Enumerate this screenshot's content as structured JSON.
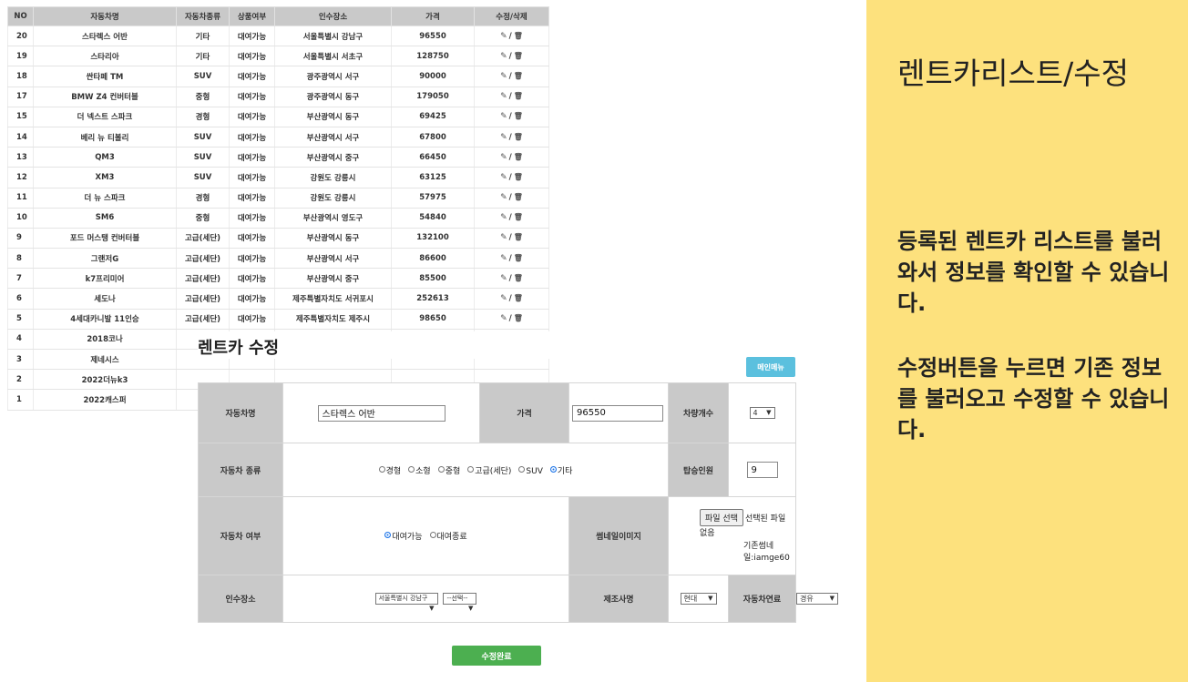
{
  "list": {
    "headers": [
      "NO",
      "자동차명",
      "자동차종류",
      "상품여부",
      "인수장소",
      "가격",
      "수정/삭제"
    ],
    "rows": [
      {
        "no": "20",
        "name": "스타렉스 어반",
        "type": "기타",
        "status": "대여가능",
        "place": "서울특별시 강남구",
        "price": "96550"
      },
      {
        "no": "19",
        "name": "스타리아",
        "type": "기타",
        "status": "대여가능",
        "place": "서울특별시 서초구",
        "price": "128750"
      },
      {
        "no": "18",
        "name": "싼타페 TM",
        "type": "SUV",
        "status": "대여가능",
        "place": "광주광역시 서구",
        "price": "90000"
      },
      {
        "no": "17",
        "name": "BMW Z4 컨버터블",
        "type": "중형",
        "status": "대여가능",
        "place": "광주광역시 동구",
        "price": "179050"
      },
      {
        "no": "15",
        "name": "더 넥스트 스파크",
        "type": "경형",
        "status": "대여가능",
        "place": "부산광역시 동구",
        "price": "69425"
      },
      {
        "no": "14",
        "name": "베리 뉴 티볼리",
        "type": "SUV",
        "status": "대여가능",
        "place": "부산광역시 서구",
        "price": "67800"
      },
      {
        "no": "13",
        "name": "QM3",
        "type": "SUV",
        "status": "대여가능",
        "place": "부산광역시 중구",
        "price": "66450"
      },
      {
        "no": "12",
        "name": "XM3",
        "type": "SUV",
        "status": "대여가능",
        "place": "강원도 강릉시",
        "price": "63125"
      },
      {
        "no": "11",
        "name": "더 뉴 스파크",
        "type": "경형",
        "status": "대여가능",
        "place": "강원도 강릉시",
        "price": "57975"
      },
      {
        "no": "10",
        "name": "SM6",
        "type": "중형",
        "status": "대여가능",
        "place": "부산광역시 영도구",
        "price": "54840"
      },
      {
        "no": "9",
        "name": "포드 머스탱 컨버터블",
        "type": "고급(세단)",
        "status": "대여가능",
        "place": "부산광역시 동구",
        "price": "132100"
      },
      {
        "no": "8",
        "name": "그랜저G",
        "type": "고급(세단)",
        "status": "대여가능",
        "place": "부산광역시 서구",
        "price": "86600"
      },
      {
        "no": "7",
        "name": "k7프리미어",
        "type": "고급(세단)",
        "status": "대여가능",
        "place": "부산광역시 중구",
        "price": "85500"
      },
      {
        "no": "6",
        "name": "세도나",
        "type": "고급(세단)",
        "status": "대여가능",
        "place": "제주특별자치도 서귀포시",
        "price": "252613"
      },
      {
        "no": "5",
        "name": "4세대카니발 11인승",
        "type": "고급(세단)",
        "status": "대여가능",
        "place": "제주특별자치도 제주시",
        "price": "98650"
      },
      {
        "no": "4",
        "name": "2018코나",
        "type": "",
        "status": "",
        "place": "",
        "price": ""
      },
      {
        "no": "3",
        "name": "제네시스",
        "type": "",
        "status": "",
        "place": "",
        "price": ""
      },
      {
        "no": "2",
        "name": "2022더뉴k3",
        "type": "",
        "status": "",
        "place": "",
        "price": ""
      },
      {
        "no": "1",
        "name": "2022캐스퍼",
        "type": "",
        "status": "",
        "place": "",
        "price": ""
      }
    ],
    "edit_icon": "✎",
    "sep": "/",
    "delete_icon": "🗑"
  },
  "edit": {
    "title": "렌트카 수정",
    "menu_button": "메인메뉴",
    "labels": {
      "car_name": "자동차명",
      "price": "가격",
      "car_count": "차량개수",
      "car_type": "자동차 종류",
      "seats": "탑승인원",
      "availability": "자동차 여부",
      "thumbnail": "썸네일이미지",
      "location": "인수장소",
      "maker": "제조사명",
      "fuel": "자동차연료"
    },
    "values": {
      "car_name": "스타렉스 어반",
      "price": "96550",
      "car_count": "4",
      "seats": "9",
      "location_city": "서울특별시 강남구",
      "location_district": "--선택--",
      "maker": "현대",
      "fuel": "경유"
    },
    "car_types": [
      {
        "label": "경형",
        "checked": false
      },
      {
        "label": "소형",
        "checked": false
      },
      {
        "label": "중형",
        "checked": false
      },
      {
        "label": "고급(세단)",
        "checked": false
      },
      {
        "label": "SUV",
        "checked": false
      },
      {
        "label": "기타",
        "checked": true
      }
    ],
    "availability_options": [
      {
        "label": "대여가능",
        "checked": true
      },
      {
        "label": "대여종료",
        "checked": false
      }
    ],
    "file": {
      "button": "파일 선택",
      "status": "선택된 파일 없음",
      "existing": "기존썸네일:iamge60"
    },
    "submit": "수정완료"
  },
  "side": {
    "title": "렌트카리스트/수정",
    "desc1": "등록된 렌트카 리스트를 불러와서 정보를 확인할 수 있습니다.",
    "desc2": "수정버튼을 누르면 기존 정보를 불러오고 수정할 수 있습니다."
  },
  "colors": {
    "side_bg": "#fde17d",
    "header_bg": "#c9c9c9",
    "menu_btn": "#5bc0de",
    "submit_btn": "#4caf50"
  }
}
